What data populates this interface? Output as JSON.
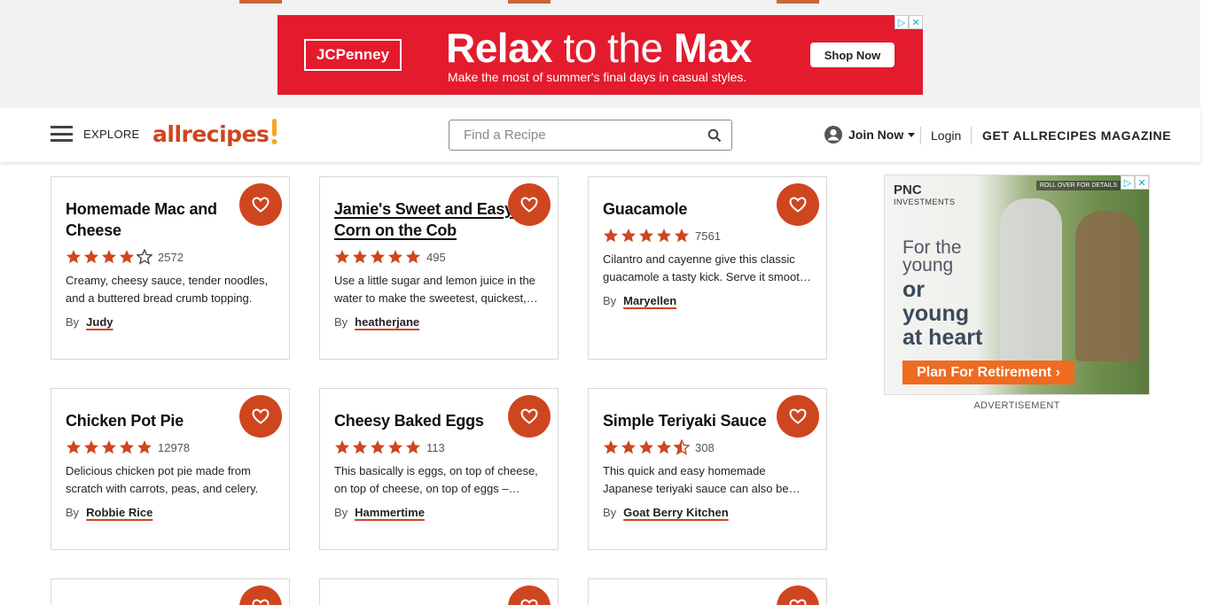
{
  "top_ad": {
    "brand": "JCPenney",
    "headline_bold_1": "Relax",
    "headline_thin": " to the ",
    "headline_bold_2": "Max",
    "subtext": "Make the most of summer's final days in casual styles.",
    "cta": "Shop Now",
    "ad_choices_icons": [
      "info-icon",
      "close-icon"
    ]
  },
  "header": {
    "explore_label": "EXPLORE",
    "logo_text": "allrecipes",
    "search_placeholder": "Find a Recipe",
    "join_label": "Join Now",
    "login_label": "Login",
    "magazine_label": "GET ALLRECIPES MAGAZINE"
  },
  "colors": {
    "accent": "#ce4620",
    "ad_red": "#e31b2d",
    "star": "#ce4620"
  },
  "byline_prefix": "By",
  "cards": [
    {
      "title": "Homemade Mac and Cheese",
      "rating": 4,
      "count": "2572",
      "description": "Creamy, cheesy sauce, tender noodles, and a buttered bread crumb topping.",
      "author": "Judy"
    },
    {
      "title": "Jamie's Sweet and Easy Corn on the Cob",
      "rating": 5,
      "count": "495",
      "description": "Use a little sugar and lemon juice in the water to make the sweetest, quickest, and easiest corn on the cob.",
      "author": "heatherjane"
    },
    {
      "title": "Guacamole",
      "rating": 5,
      "count": "7561",
      "description": "Cilantro and cayenne give this classic guacamole a tasty kick. Serve it smooth or chunky.",
      "author": "Maryellen"
    },
    {
      "title": "Chicken Pot Pie",
      "rating": 5,
      "count": "12978",
      "description": "Delicious chicken pot pie made from scratch with carrots, peas, and celery.",
      "author": "Robbie Rice"
    },
    {
      "title": "Cheesy Baked Eggs",
      "rating": 5,
      "count": "113",
      "description": "This basically is eggs, on top of cheese, on top of cheese, on top of eggs – baked.",
      "author": "Hammertime"
    },
    {
      "title": "Simple Teriyaki Sauce",
      "rating": 4.5,
      "count": "308",
      "description": "This quick and easy homemade Japanese teriyaki sauce can also be used as a marinade.",
      "author": "Goat Berry Kitchen"
    }
  ],
  "side_ad": {
    "brand": "PNC",
    "brand_sub": "INVESTMENTS",
    "rollover": "ROLL OVER FOR DETAILS",
    "line1a": "For the",
    "line1b": "young",
    "line2a": "or",
    "line2b": "young",
    "line2c": "at heart",
    "cta": "Plan For Retirement ›",
    "label": "ADVERTISEMENT"
  }
}
